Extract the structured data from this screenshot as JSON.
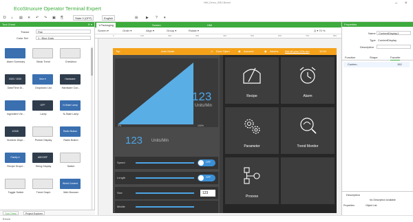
{
  "app": {
    "title": "EcoStruxure Operator Terminal Expert",
    "window_title": "HMI_Demo_ISSU.Boxed",
    "win_controls": [
      "–",
      "×"
    ]
  },
  "toolbar": {
    "icons": [
      "D",
      "⌂",
      "▤",
      "✕",
      "↶",
      "↷",
      "▣",
      "⎘"
    ],
    "state_combo": "State 0 (OFF)",
    "lang_combo": "English",
    "icons2": [
      "⊞",
      "▶",
      "?",
      "▾"
    ]
  },
  "left_panel": {
    "title": "Tool Chest",
    "controls": "✕ ▾",
    "theme_label": "Theme",
    "theme_value": "Flat",
    "colorset_label": "Color Set",
    "colorset_value": "1 : Blue Dark",
    "tools": [
      {
        "label": "Alarm Summary",
        "thumb": "",
        "style": "blue"
      },
      {
        "label": "Block Trend",
        "thumb": "",
        "style": "light"
      },
      {
        "label": "Checkbox",
        "thumb": "",
        "style": "light"
      },
      {
        "label": "Date/Time Di...",
        "thumb": "2020 / 2020",
        "style": "dark"
      },
      {
        "label": "Dropdown List",
        "thumb": "Item ▾",
        "style": "blue"
      },
      {
        "label": "Hardware Con...",
        "thumb": "Hardware configuration",
        "style": "dark"
      },
      {
        "label": "Ingredient Vie...",
        "thumb": "",
        "style": "blue"
      },
      {
        "label": "Lamp",
        "thumb": "OFF",
        "style": "dark"
      },
      {
        "label": "N-State Lamp",
        "thumb": "N-State Lamp",
        "style": "blue"
      },
      {
        "label": "Numeric Displ...",
        "thumb": "12345",
        "style": "dark"
      },
      {
        "label": "Picture Display",
        "thumb": "",
        "style": "light"
      },
      {
        "label": "Radio Button",
        "thumb": "Radio Button",
        "style": "blue"
      },
      {
        "label": "Recipe Dropd...",
        "thumb": "Family ▾",
        "style": "blue"
      },
      {
        "label": "String Display",
        "thumb": "ABCDEF",
        "style": "dark"
      },
      {
        "label": "Switch",
        "thumb": "",
        "style": "light"
      },
      {
        "label": "Toggle Switch",
        "thumb": "",
        "style": "light"
      },
      {
        "label": "Trend Graph",
        "thumb": "",
        "style": "light"
      },
      {
        "label": "Web Browser",
        "thumb": "World Content",
        "style": "blue"
      }
    ],
    "bottom_tabs": [
      "Tool Chest",
      "Project Explorer"
    ]
  },
  "center": {
    "tabs": [
      "1:Packaging",
      "Screen",
      "HMI"
    ],
    "toolbar": [
      "Screen ▾",
      "Order ▾",
      "Align ▾",
      "Group ▾",
      "Rotate ▾",
      "Q ▾ 70 %"
    ],
    "ruler": [
      "0",
      "100",
      "200",
      "300",
      "400",
      "500",
      "600",
      "700",
      "800"
    ],
    "statusbar": {
      "left": "Top",
      "center": "Auto Mode",
      "door": "Door Open",
      "account": "Account",
      "alarm": "Alarms",
      "alarm_text": "Not all your I/Os run",
      "time": "12:34"
    },
    "gauge": {
      "value": "123",
      "units": "Units/Min",
      "pct0": "0%",
      "pct100": "100%",
      "readout": "123",
      "readout_units": "Units/Min",
      "level": 1.0
    },
    "controls": [
      {
        "label": "Speed",
        "type": "toggle",
        "toggle": "OFF"
      },
      {
        "label": "Length",
        "type": "toggle",
        "toggle": "OFF"
      },
      {
        "label": "Size",
        "type": "input",
        "value": "123"
      },
      {
        "label": "Middle",
        "type": "slider"
      }
    ],
    "tiles": [
      {
        "label": "Recipe",
        "icon": "recipe-icon"
      },
      {
        "label": "Alarm",
        "icon": "alarm-clock-icon"
      },
      {
        "label": "Parameter",
        "icon": "gears-icon"
      },
      {
        "label": "Trend Monitor",
        "icon": "trend-monitor-icon"
      },
      {
        "label": "Process",
        "icon": "process-icon"
      },
      {
        "label": "",
        "icon": ""
      }
    ]
  },
  "right_panel": {
    "title": "Properties",
    "name_label": "Name",
    "name_value": "ContentDisplay1",
    "type_label": "Type",
    "type_value": "ContentDisplay",
    "desc_label": "Description",
    "tabs": [
      "Function",
      "Shape",
      "Favorite"
    ],
    "item_label": "Conten...",
    "item_value": "152",
    "bottom_label": "Description",
    "bottom_text": "No Description Available",
    "bottom_tabs": [
      "Properties",
      "Object List"
    ]
  },
  "footer": {
    "status": "Errors"
  }
}
